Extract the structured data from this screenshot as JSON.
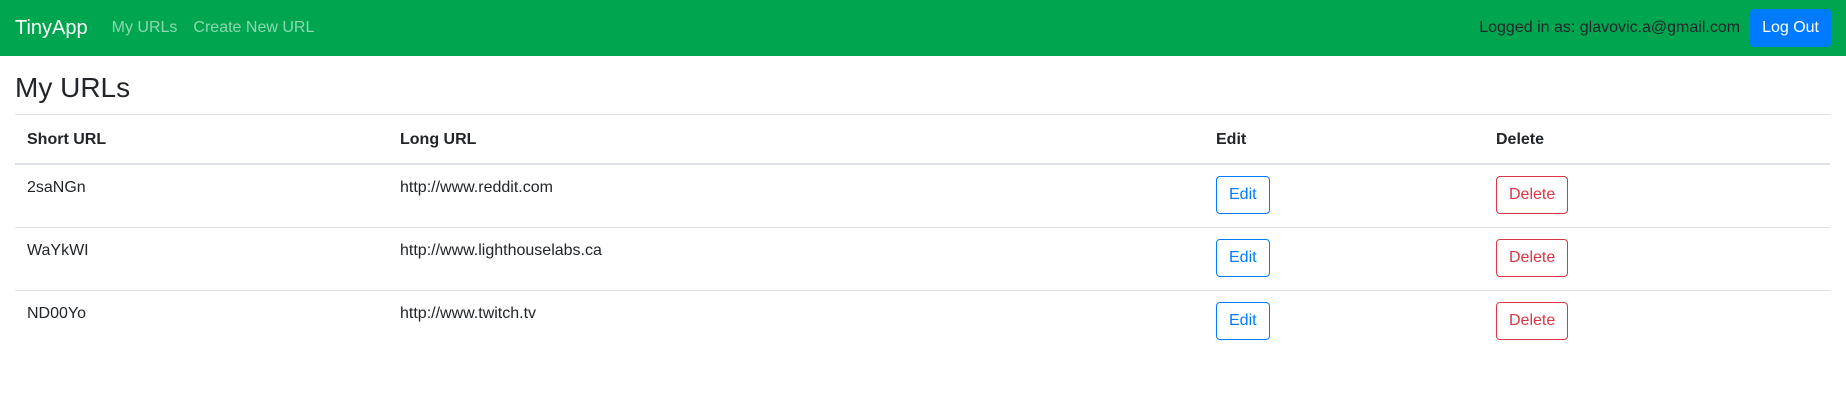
{
  "nav": {
    "brand": "TinyApp",
    "links": [
      "My URLs",
      "Create New URL"
    ],
    "logged_in_text": "Logged in as: glavovic.a@gmail.com",
    "logout_label": "Log Out"
  },
  "page": {
    "title": "My URLs"
  },
  "table": {
    "headers": [
      "Short URL",
      "Long URL",
      "Edit",
      "Delete"
    ],
    "rows": [
      {
        "short": "2saNGn",
        "long": "http://www.reddit.com",
        "edit": "Edit",
        "delete": "Delete"
      },
      {
        "short": "WaYkWI",
        "long": "http://www.lighthouselabs.ca",
        "edit": "Edit",
        "delete": "Delete"
      },
      {
        "short": "ND00Yo",
        "long": "http://www.twitch.tv",
        "edit": "Edit",
        "delete": "Delete"
      }
    ]
  },
  "colors": {
    "navbar": "#00a64f",
    "primary": "#007bff",
    "danger": "#dc3545"
  }
}
